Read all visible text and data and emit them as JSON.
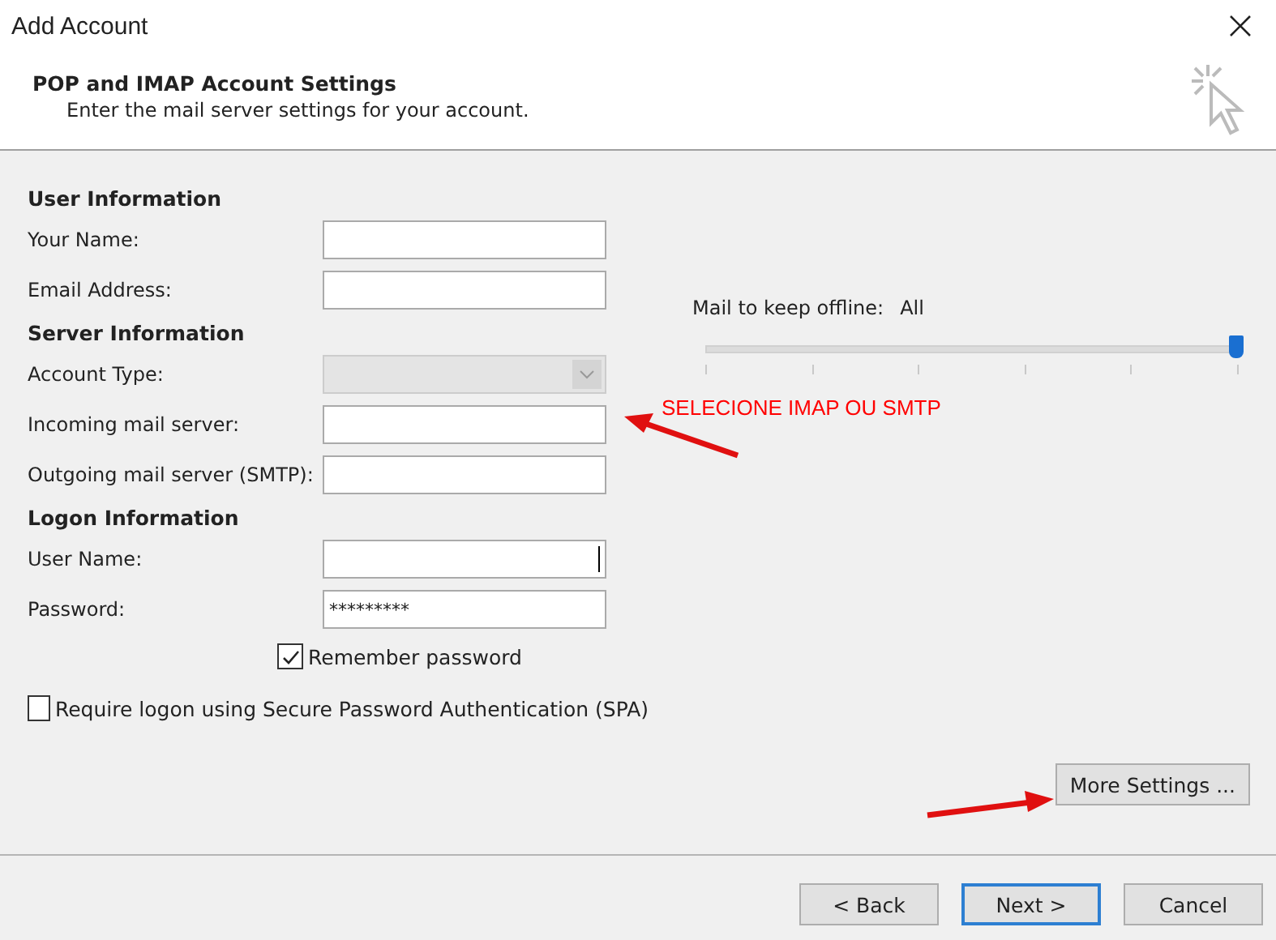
{
  "window": {
    "title": "Add Account"
  },
  "header": {
    "title": "POP and IMAP Account Settings",
    "subtitle": "Enter the mail server settings for your account."
  },
  "sections": [
    {
      "heading": "User Information",
      "fields": [
        {
          "label": "Your Name:",
          "kind": "text",
          "disabled": false
        },
        {
          "label": "Email Address:",
          "kind": "text",
          "disabled": false
        }
      ]
    },
    {
      "heading": "Server Information",
      "fields": [
        {
          "label": "Account Type:",
          "kind": "dropdown",
          "disabled": true
        },
        {
          "label": "Incoming mail server:",
          "kind": "text",
          "disabled": false
        },
        {
          "label": "Outgoing mail server (SMTP):",
          "kind": "text",
          "disabled": false
        }
      ]
    },
    {
      "heading": "Logon Information",
      "fields": [
        {
          "label": "User Name:",
          "kind": "text",
          "disabled": false,
          "focused": true
        },
        {
          "label": "Password:",
          "kind": "text",
          "disabled": false,
          "value": "*********"
        }
      ]
    }
  ],
  "checkboxes": [
    {
      "label": "Remember password",
      "checked": true,
      "kind": "indented"
    },
    {
      "label": "Require logon using Secure Password Authentication (SPA)",
      "checked": false,
      "kind": "plain"
    }
  ],
  "offline": {
    "label": "Mail to keep offline:",
    "value": "All",
    "level": 1
  },
  "annotation": {
    "text": "SELECIONE IMAP OU SMTP"
  },
  "more_settings_button": "More Settings ...",
  "buttons": [
    {
      "label": "< Back",
      "default": false
    },
    {
      "label": "Next >",
      "default": true
    },
    {
      "label": "Cancel",
      "default": false
    }
  ]
}
